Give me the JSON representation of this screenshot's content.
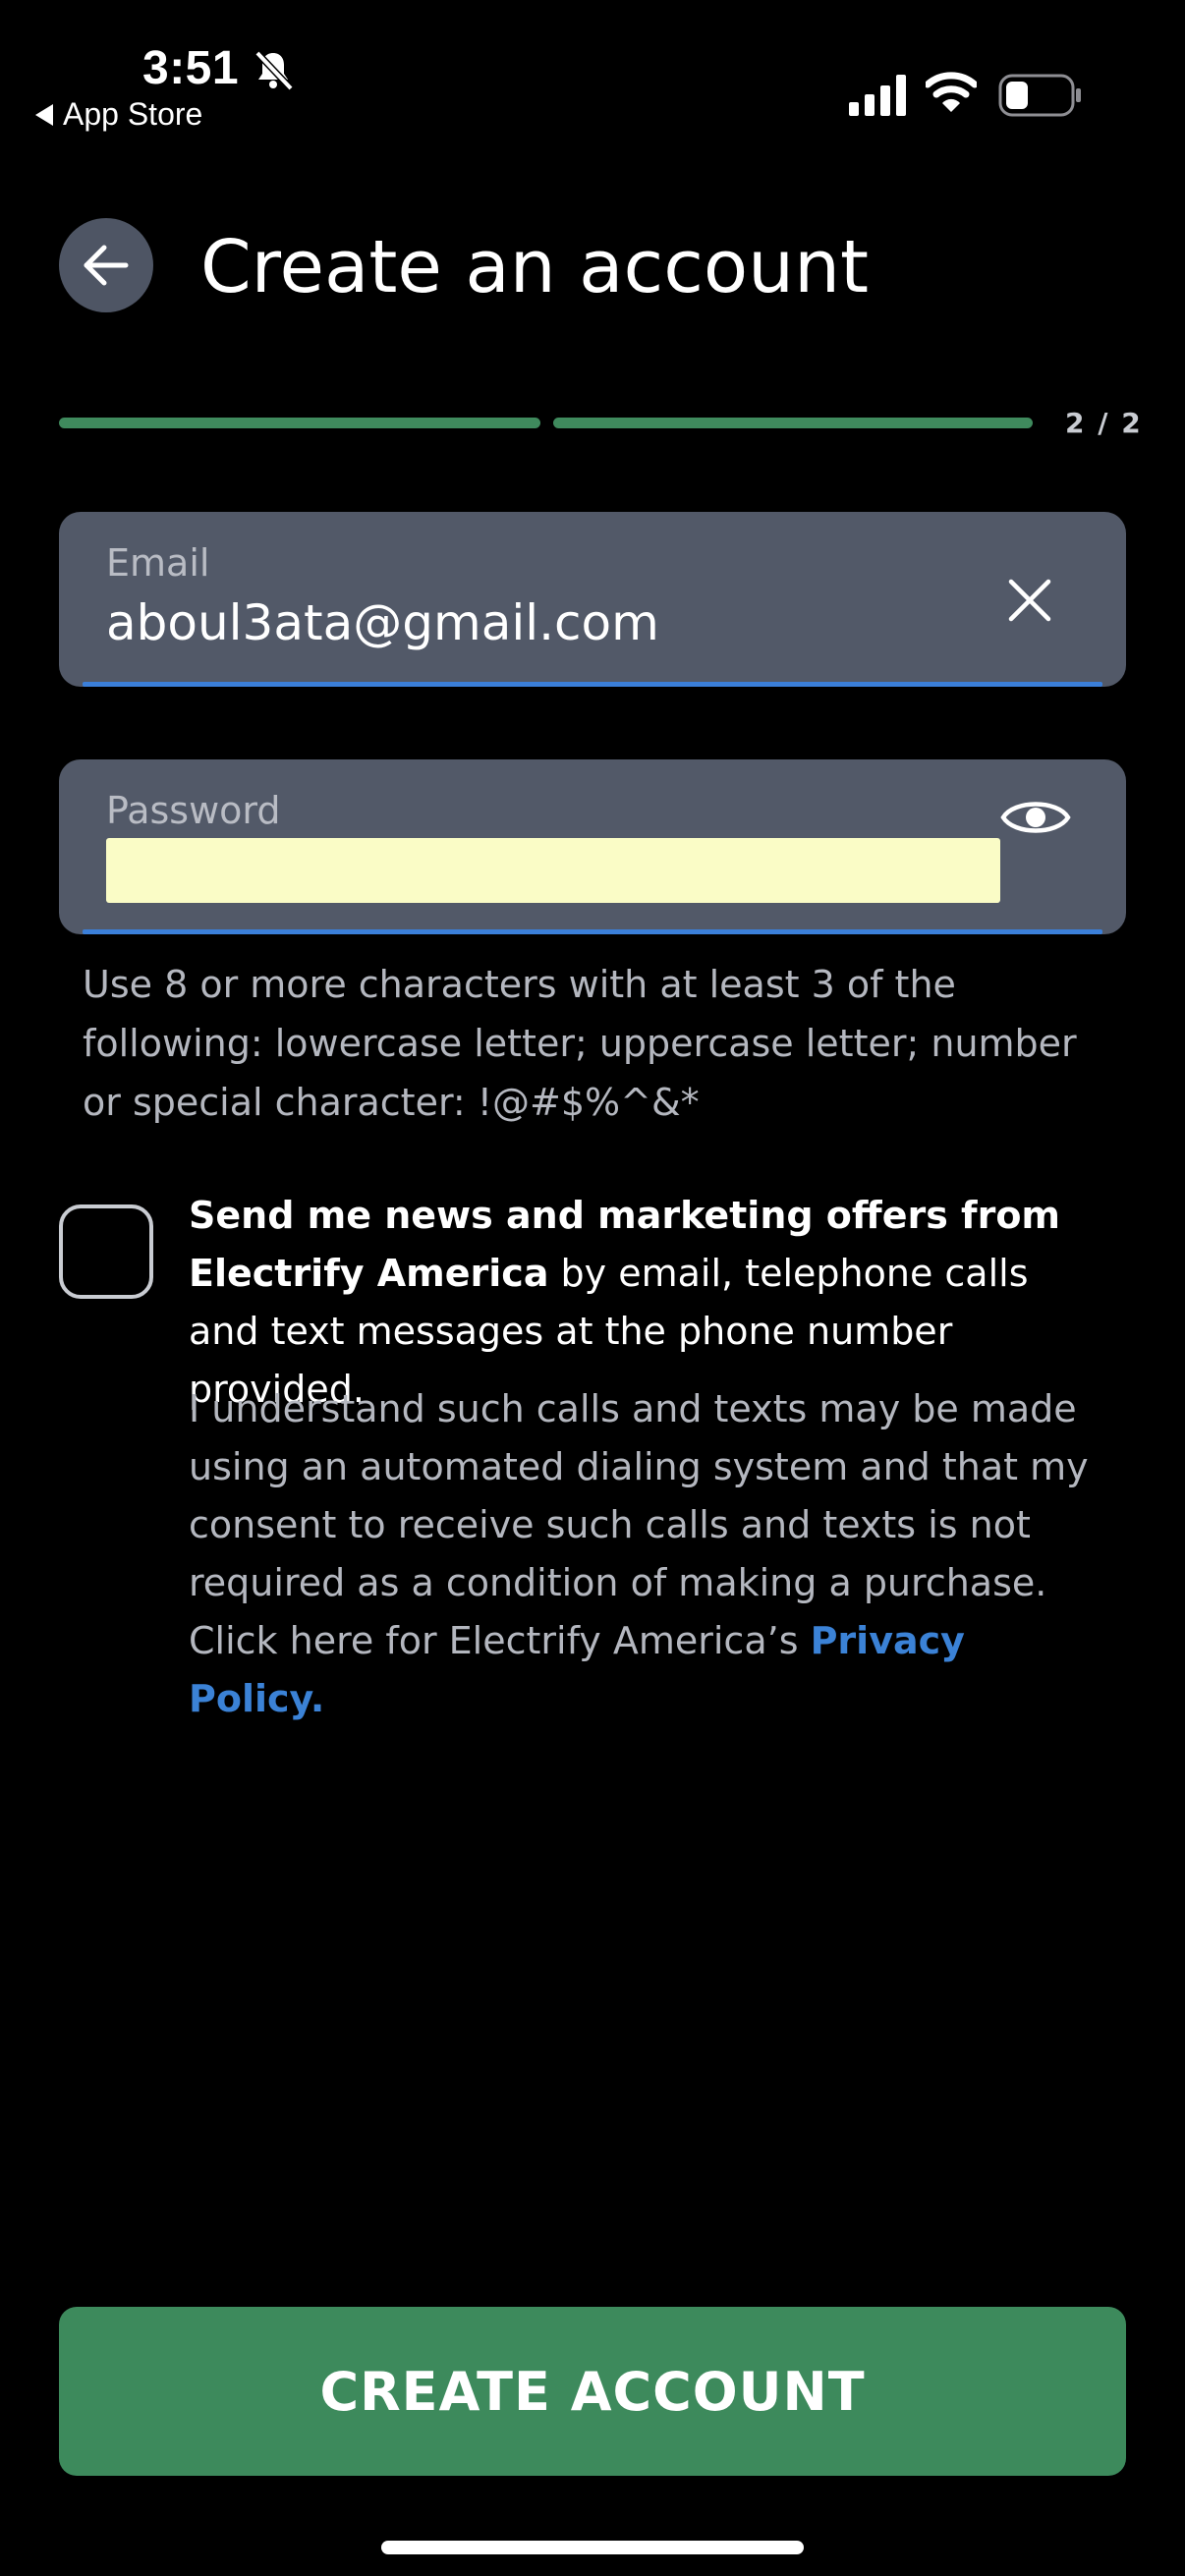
{
  "status_bar": {
    "time": "3:51",
    "back_app": "App Store"
  },
  "header": {
    "title": "Create an account"
  },
  "progress": {
    "label": "2 / 2",
    "current_step": 2,
    "total_steps": 2
  },
  "email_field": {
    "label": "Email",
    "value": "aboul3ata@gmail.com"
  },
  "password_field": {
    "label": "Password",
    "value": ""
  },
  "password_hint": "Use 8 or more characters with at least 3 of the following: lowercase letter; uppercase letter; number or special character: !@#$%^&*",
  "consent": {
    "bold_text": "Send me news and marketing offers from Electrify America",
    "rest_text": " by email, telephone calls and text messages at the phone number provided.",
    "sub_text": "I understand such calls and texts may be made using an automated dialing system and that my consent to receive such calls and texts is not required as a condition of making a purchase. Click here for Electrify America’s ",
    "privacy_link": "Privacy Policy.",
    "checked": false
  },
  "actions": {
    "create_label": "CREATE ACCOUNT"
  },
  "colors": {
    "accent_green": "#3d8a5c",
    "field_bg": "#525968",
    "focus_blue": "#3b7fd9",
    "link_blue": "#3b82d6"
  }
}
